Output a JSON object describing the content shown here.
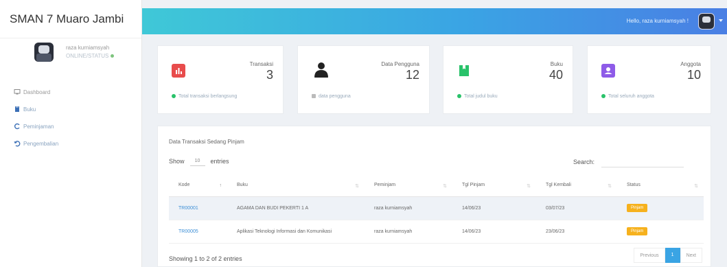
{
  "app": {
    "brand": "SMAN 7 Muaro Jambi"
  },
  "sidebar": {
    "user_name": "raza kurniamsyah",
    "status": "ONLINE/STATUS",
    "items": [
      {
        "label": "Dashboard",
        "icon": "monitor-icon"
      },
      {
        "label": "Buku",
        "icon": "book-icon"
      },
      {
        "label": "Peminjaman",
        "icon": "refresh-icon"
      },
      {
        "label": "Pengembalian",
        "icon": "undo-icon"
      }
    ]
  },
  "header": {
    "greeting": "Hello, raza kurniamsyah !"
  },
  "stats": [
    {
      "label": "Transaksi",
      "value": "3",
      "footer": "Total transaksi berlangsung",
      "color": "#e84c4c",
      "icon": "chart-icon"
    },
    {
      "label": "Data Pengguna",
      "value": "12",
      "footer": "data pengguna",
      "color": "#222222",
      "icon": "user-icon"
    },
    {
      "label": "Buku",
      "value": "40",
      "footer": "Total judul buku",
      "color": "#29c26a",
      "icon": "bookmark-icon"
    },
    {
      "label": "Anggota",
      "value": "10",
      "footer": "Total seluruh anggota",
      "color": "#8e5be8",
      "icon": "badge-icon"
    }
  ],
  "table_panel": {
    "title": "Data Transaksi Sedang Pinjam",
    "show_label": "Show",
    "show_value": "10",
    "entries_label": "entries",
    "search_label": "Search:",
    "search_placeholder": "",
    "columns": [
      "Kode",
      "Buku",
      "Peminjam",
      "Tgl Pinjam",
      "Tgl Kembali",
      "Status"
    ],
    "rows": [
      {
        "kode": "TR00001",
        "buku": "AGAMA DAN BUDI PEKERTI 1 A",
        "peminjam": "raza kurniamsyah",
        "tgl_pinjam": "14/06/23",
        "tgl_kembali": "03/07/23",
        "status": "Pinjam"
      },
      {
        "kode": "TR00005",
        "buku": "Aplikasi Teknologi Informasi dan Komunikasi",
        "peminjam": "raza kurniamsyah",
        "tgl_pinjam": "14/06/23",
        "tgl_kembali": "23/06/23",
        "status": "Pinjam"
      }
    ],
    "info": "Showing 1 to 2 of 2 entries",
    "pager": {
      "prev": "Previous",
      "page": "1",
      "next": "Next"
    }
  }
}
